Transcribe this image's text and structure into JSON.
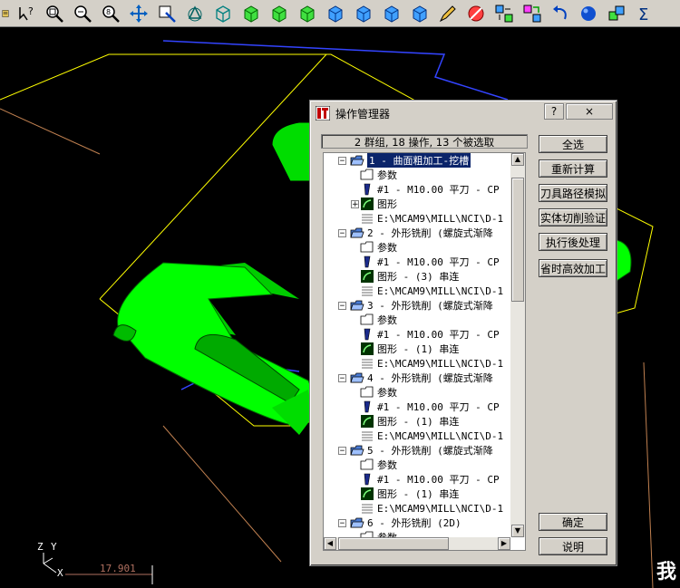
{
  "dialog": {
    "title": "操作管理器",
    "help": "?",
    "close": "×",
    "summary": "2 群组, 18 操作, 13 个被选取"
  },
  "tree": [
    {
      "kind": "op",
      "text": "1 - 曲面粗加工-挖槽",
      "selected": true
    },
    {
      "kind": "param",
      "text": "参数"
    },
    {
      "kind": "tool",
      "text": "#1 - M10.00 平刀 - CP"
    },
    {
      "kind": "geom",
      "text": "图形"
    },
    {
      "kind": "nci",
      "text": "E:\\MCAM9\\MILL\\NCI\\D-1"
    },
    {
      "kind": "op",
      "text": "2 - 外形铣削 (螺旋式渐降"
    },
    {
      "kind": "param",
      "text": "参数"
    },
    {
      "kind": "tool",
      "text": "#1 - M10.00 平刀 - CP"
    },
    {
      "kind": "geom",
      "text": "图形 - (3) 串连"
    },
    {
      "kind": "nci",
      "text": "E:\\MCAM9\\MILL\\NCI\\D-1"
    },
    {
      "kind": "op",
      "text": "3 - 外形铣削 (螺旋式渐降"
    },
    {
      "kind": "param",
      "text": "参数"
    },
    {
      "kind": "tool",
      "text": "#1 - M10.00 平刀 - CP"
    },
    {
      "kind": "geom",
      "text": "图形 - (1) 串连"
    },
    {
      "kind": "nci",
      "text": "E:\\MCAM9\\MILL\\NCI\\D-1"
    },
    {
      "kind": "op",
      "text": "4 - 外形铣削 (螺旋式渐降"
    },
    {
      "kind": "param",
      "text": "参数"
    },
    {
      "kind": "tool",
      "text": "#1 - M10.00 平刀 - CP"
    },
    {
      "kind": "geom",
      "text": "图形 - (1) 串连"
    },
    {
      "kind": "nci",
      "text": "E:\\MCAM9\\MILL\\NCI\\D-1"
    },
    {
      "kind": "op",
      "text": "5 - 外形铣削 (螺旋式渐降"
    },
    {
      "kind": "param",
      "text": "参数"
    },
    {
      "kind": "tool",
      "text": "#1 - M10.00 平刀 - CP"
    },
    {
      "kind": "geom",
      "text": "图形 - (1) 串连"
    },
    {
      "kind": "nci",
      "text": "E:\\MCAM9\\MILL\\NCI\\D-1"
    },
    {
      "kind": "op",
      "text": "6 - 外形铣削 (2D)"
    },
    {
      "kind": "param",
      "text": "参数"
    }
  ],
  "buttons": {
    "select_all": "全选",
    "regenerate": "重新计算",
    "backplot": "刀具路径模拟",
    "verify": "实体切削验证",
    "post": "执行後处理",
    "highfeed": "省时高效加工",
    "ok": "确定",
    "help": "说明"
  },
  "axes": {
    "z": "Z",
    "y": "Y",
    "x": "X",
    "scale": "17.901"
  },
  "corner_glyph": "我",
  "colors": {
    "part": "#00ff00",
    "boundary": "#ffff00",
    "toolpath": "#3333ff",
    "selection": "#0a246a",
    "window": "#d4d0c8"
  },
  "toolbar_icons": [
    "layer-icon",
    "help-arrow-icon",
    "zoom-window-icon",
    "zoom-out-icon",
    "zoom-8-icon",
    "pan-icon",
    "fit-icon",
    "rotate-icon",
    "cube-wire-icon",
    "cube-green-icon",
    "cube-green-icon",
    "cube-green-icon",
    "cube-blue-icon",
    "cube-blue-icon",
    "cube-blue-icon",
    "cube-blue-icon",
    "pencil-icon",
    "no-entry-icon",
    "split-view-icon",
    "layout-icon",
    "undo-icon",
    "sphere-icon",
    "snap-icon",
    "sigma-icon"
  ]
}
